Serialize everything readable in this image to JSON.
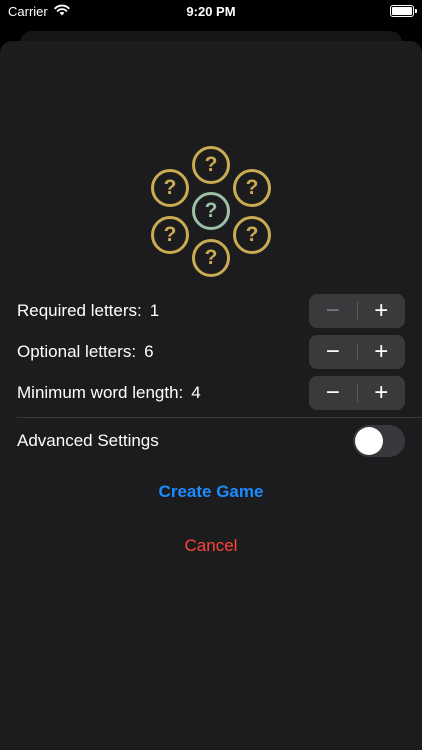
{
  "status": {
    "carrier": "Carrier",
    "time": "9:20 PM"
  },
  "hive": {
    "glyph": "?",
    "outer_color": "#c9ac52",
    "center_color": "#9dbfa6"
  },
  "settings": {
    "required": {
      "label": "Required letters:",
      "value": "1"
    },
    "optional": {
      "label": "Optional letters:",
      "value": "6"
    },
    "min_length": {
      "label": "Minimum word length:",
      "value": "4"
    },
    "advanced": {
      "label": "Advanced Settings",
      "enabled": false
    }
  },
  "stepper": {
    "minus": "−",
    "plus": "+"
  },
  "actions": {
    "create": "Create Game",
    "cancel": "Cancel"
  },
  "colors": {
    "create": "#1a8cff",
    "cancel": "#ff453a",
    "sheet": "#1c1c1e"
  }
}
